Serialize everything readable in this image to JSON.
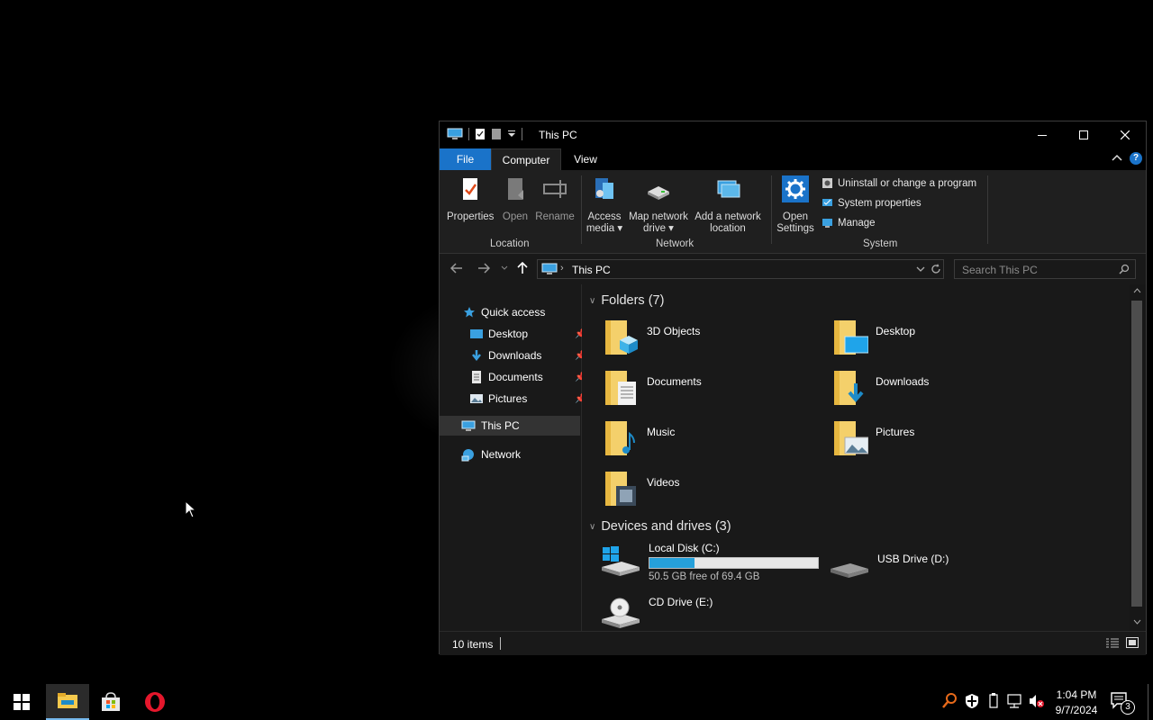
{
  "window": {
    "title": "This PC",
    "tabs": [
      "File",
      "Computer",
      "View"
    ],
    "help_label": "?"
  },
  "ribbon": {
    "location": {
      "label": "Location",
      "properties": "Properties",
      "open": "Open",
      "rename": "Rename"
    },
    "network": {
      "label": "Network",
      "access_media": [
        "Access",
        "media ▾"
      ],
      "map_drive": [
        "Map network",
        "drive ▾"
      ],
      "add_location": [
        "Add a network",
        "location"
      ]
    },
    "system": {
      "label": "System",
      "open_settings": [
        "Open",
        "Settings"
      ],
      "uninstall": "Uninstall or change a program",
      "system_properties": "System properties",
      "manage": "Manage"
    }
  },
  "address": {
    "path": "This PC",
    "search_placeholder": "Search This PC"
  },
  "nav": {
    "quick_access": "Quick access",
    "items": [
      "Desktop",
      "Downloads",
      "Documents",
      "Pictures"
    ],
    "this_pc": "This PC",
    "network": "Network"
  },
  "content": {
    "folders_header": "Folders (7)",
    "folders": [
      "3D Objects",
      "Desktop",
      "Documents",
      "Downloads",
      "Music",
      "Pictures",
      "Videos"
    ],
    "drives_header": "Devices and drives (3)",
    "drives": [
      {
        "name": "Local Disk (C:)",
        "free": "50.5 GB free of 69.4 GB",
        "used_fraction": 0.27
      },
      {
        "name": "USB Drive (D:)"
      },
      {
        "name": "CD Drive (E:)"
      }
    ]
  },
  "status": {
    "items": "10 items"
  },
  "taskbar": {
    "time": "1:04 PM",
    "date": "9/7/2024",
    "notifications": "3"
  }
}
